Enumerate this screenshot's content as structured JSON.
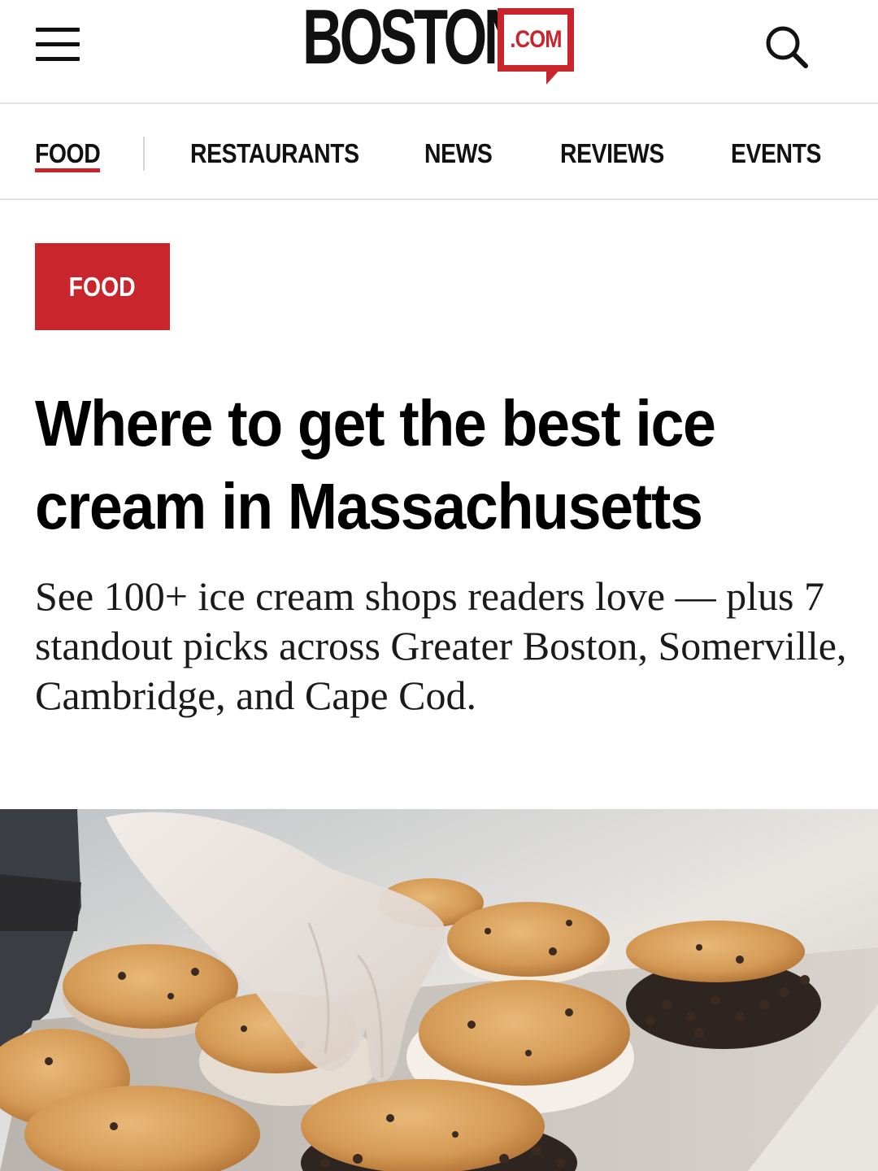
{
  "header": {
    "menu_icon": "hamburger-menu-icon",
    "logo": {
      "wordmark": "BOSTON",
      "suffix": ".COM",
      "brand_color": "#c8252c"
    },
    "search_icon": "search-icon"
  },
  "nav": {
    "items": [
      {
        "label": "FOOD",
        "active": true
      },
      {
        "label": "RESTAURANTS"
      },
      {
        "label": "NEWS"
      },
      {
        "label": "REVIEWS"
      },
      {
        "label": "EVENTS"
      }
    ],
    "active_color": "#c8252c"
  },
  "article": {
    "category": "FOOD",
    "headline": "Where to get the best ice cream in Massachusetts",
    "dek": "See 100+ ice cream shops readers love — plus 7 standout picks across Greater Boston, Somerville, Cambridge, and Cape Cod."
  },
  "colors": {
    "accent": "#c8252c",
    "text": "#111111",
    "divider": "#e4e4e4"
  }
}
